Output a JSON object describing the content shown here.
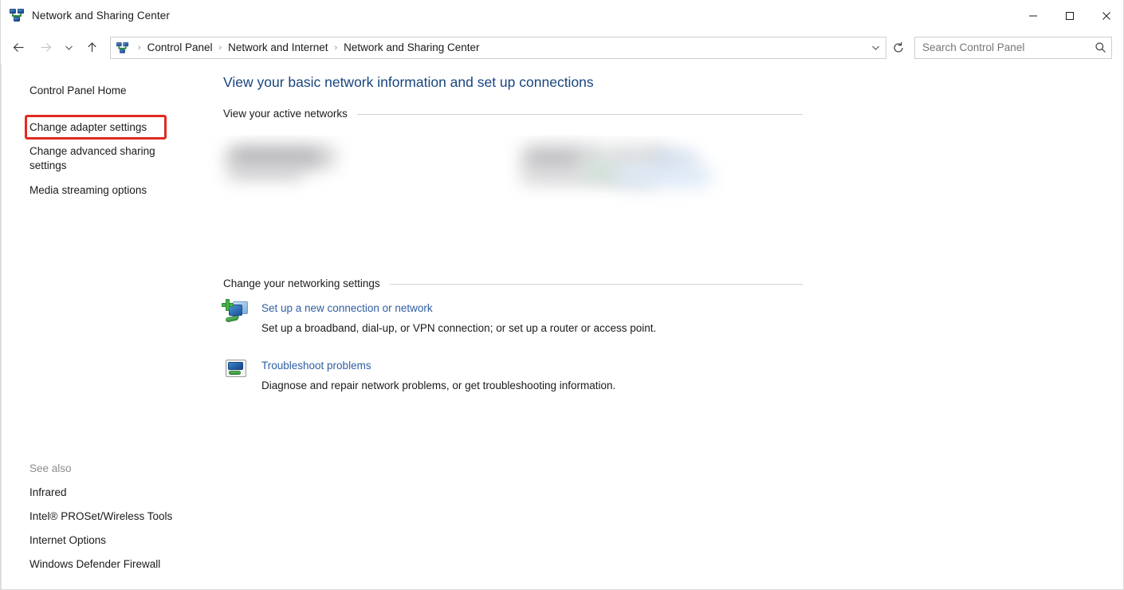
{
  "window": {
    "title": "Network and Sharing Center",
    "title_icon": "network-icon",
    "controls": {
      "minimize": "minimize-button",
      "maximize": "maximize-button",
      "close": "close-button"
    }
  },
  "navbar": {
    "back": "back-arrow-icon",
    "forward": "forward-arrow-icon",
    "recent": "chevron-down-icon",
    "up": "up-arrow-icon",
    "refresh": "refresh-icon",
    "address_icon": "network-icon",
    "breadcrumbs": [
      "Control Panel",
      "Network and Internet",
      "Network and Sharing Center"
    ],
    "breadcrumb_separator": "›",
    "dropdown": "chevron-down-icon"
  },
  "search": {
    "value": "",
    "placeholder": "Search Control Panel",
    "icon": "search-icon"
  },
  "sidebar": {
    "items": [
      {
        "label": "Control Panel Home",
        "highlighted": false
      },
      {
        "label": "Change adapter settings",
        "highlighted": true
      },
      {
        "label": "Change advanced sharing settings",
        "highlighted": false
      },
      {
        "label": "Media streaming options",
        "highlighted": false
      }
    ],
    "highlight_color": "#e02b20",
    "see_also": {
      "label": "See also",
      "items": [
        "Infrared",
        "Intel® PROSet/Wireless Tools",
        "Internet Options",
        "Windows Defender Firewall"
      ]
    }
  },
  "main": {
    "heading": "View your basic network information and set up connections",
    "heading_color": "#17457f",
    "sections": [
      {
        "label": "View your active networks"
      },
      {
        "label": "Change your networking settings"
      }
    ],
    "active_networks_redacted": true,
    "tasks": [
      {
        "icon": "new-connection-icon",
        "link": "Set up a new connection or network",
        "description": "Set up a broadband, dial-up, or VPN connection; or set up a router or access point."
      },
      {
        "icon": "troubleshoot-icon",
        "link": "Troubleshoot problems",
        "description": "Diagnose and repair network problems, or get troubleshooting information."
      }
    ],
    "link_color": "#2f5ea3"
  }
}
